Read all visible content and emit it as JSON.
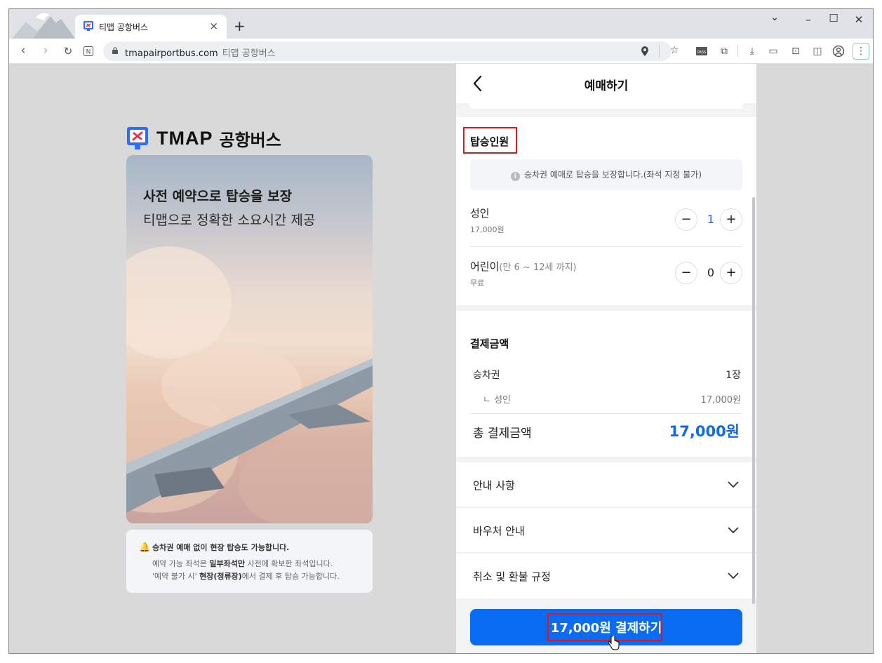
{
  "browser": {
    "tab_title": "티맵 공항버스",
    "new_tab": "+",
    "url": "tmapairportbus.com",
    "url_title": "티맵 공항버스",
    "tab_close": "×",
    "win_min": "–",
    "win_max": "☐",
    "win_close": "✕",
    "win_dropdown": "⌄"
  },
  "left": {
    "logo_text": "TMAP",
    "logo_text_kr": "공항버스",
    "hero_line1": "사전 예약으로 탑승을 보장",
    "hero_line2": "티맵으로 정확한 소요시간 제공",
    "notice": {
      "title": "승차권 예매 없이 현장 탑승도 가능합니다.",
      "line1_pre": "예약 가능 좌석은 ",
      "line1_bold": "일부좌석만",
      "line1_post": " 사전에 확보한 좌석입니다.",
      "line2_pre": "'예약 불가 시' ",
      "line2_bold": "현장(정류장)",
      "line2_post": "에서 결제 후 탑승 가능합니다."
    }
  },
  "panel": {
    "title": "예매하기",
    "passengers": {
      "title": "탑승인원",
      "info": "승차권 예매로 탑승을 보장합니다.(좌석 지정 불가)",
      "adult_label": "성인",
      "adult_price": "17,000원",
      "adult_count": "1",
      "child_label": "어린이",
      "child_note": "(만 6 ~ 12세 까지)",
      "child_price": "무료",
      "child_count": "0",
      "minus": "−",
      "plus": "+"
    },
    "payment": {
      "title": "결제금액",
      "ticket_label": "승차권",
      "ticket_value": "1장",
      "adult_label": "ㄴ 성인",
      "adult_value": "17,000원",
      "total_label": "총 결제금액",
      "total_value": "17,000원"
    },
    "accordion": [
      "안내 사항",
      "바우처 안내",
      "취소 및 환불 규정"
    ],
    "cta_label": "17,000원 결제하기"
  },
  "colors": {
    "accent": "#0a6cf2",
    "highlight": "#e0161b"
  }
}
